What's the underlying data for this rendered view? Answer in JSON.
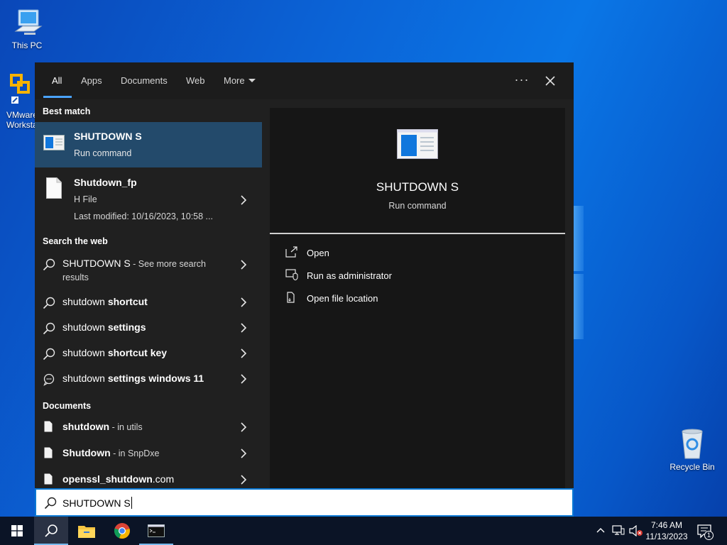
{
  "desktop": {
    "icons": [
      {
        "name": "this-pc",
        "label": "This PC"
      },
      {
        "name": "vmware",
        "label": "VMware Workstation"
      },
      {
        "name": "recycle-bin",
        "label": "Recycle Bin"
      }
    ]
  },
  "search": {
    "tabs": [
      {
        "label": "All"
      },
      {
        "label": "Apps"
      },
      {
        "label": "Documents"
      },
      {
        "label": "Web"
      },
      {
        "label": "More"
      }
    ],
    "more_icon": "ellipsis-icon",
    "close_icon": "close-icon",
    "query": "SHUTDOWN S",
    "sections": {
      "best_match": "Best match",
      "search_web": "Search the web",
      "documents": "Documents"
    },
    "best_match": {
      "title": "SHUTDOWN S",
      "subtitle": "Run command"
    },
    "file_result": {
      "title": "Shutdown_fp",
      "type": "H File",
      "modified": "Last modified: 10/16/2023, 10:58 ..."
    },
    "web_results": [
      {
        "bold": "SHUTDOWN S",
        "rest": " - See more search",
        "rest2": "results"
      },
      {
        "plain": "shutdown ",
        "bold": "shortcut"
      },
      {
        "plain": "shutdown ",
        "bold": "settings"
      },
      {
        "plain": "shutdown ",
        "bold": "shortcut key"
      },
      {
        "plain": "shutdown ",
        "bold": "settings windows 11"
      }
    ],
    "doc_results": [
      {
        "bold": "shutdown",
        "sub": " - in utils"
      },
      {
        "bold": "Shutdown",
        "sub": " - in SnpDxe"
      },
      {
        "bold": "openssl_shutdown",
        "plain": ".com"
      }
    ],
    "preview": {
      "title": "SHUTDOWN S",
      "subtitle": "Run command",
      "actions": [
        {
          "label": "Open",
          "icon": "open-icon"
        },
        {
          "label": "Run as administrator",
          "icon": "shield-icon"
        },
        {
          "label": "Open file location",
          "icon": "file-location-icon"
        }
      ]
    }
  },
  "taskbar": {
    "time": "7:46 AM",
    "date": "11/13/2023",
    "notification_count": "1",
    "apps": [
      "start-icon",
      "search-icon",
      "file-explorer-icon",
      "chrome-icon",
      "terminal-icon"
    ]
  }
}
